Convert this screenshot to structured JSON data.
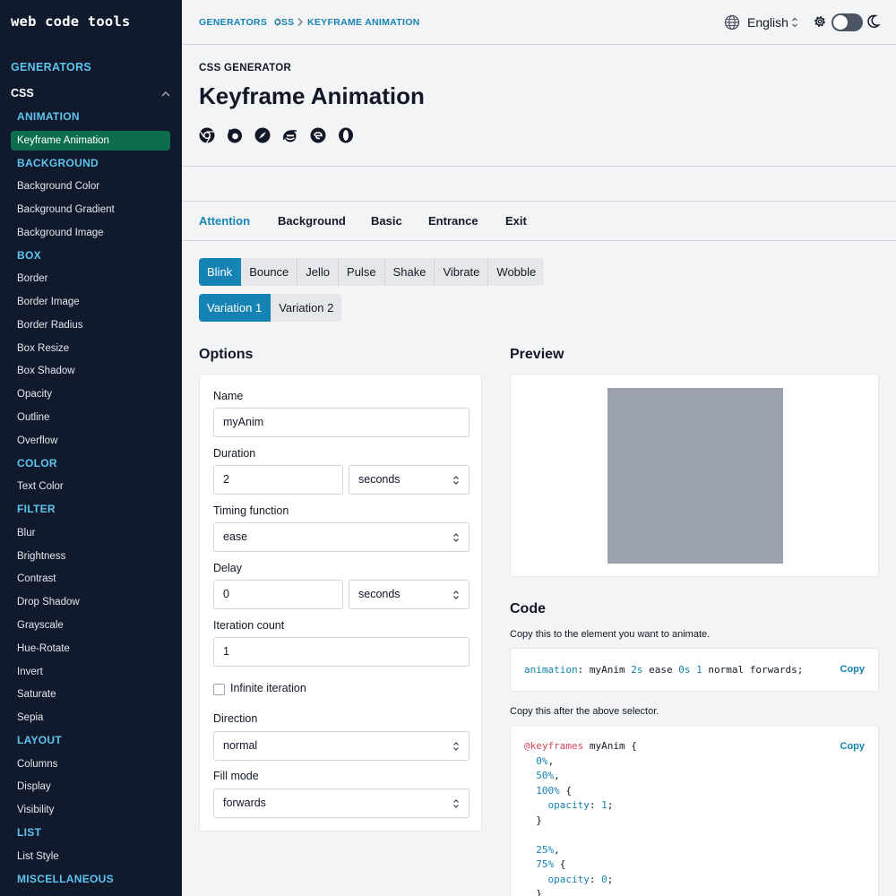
{
  "sidebar": {
    "logo": "web code tools",
    "generators": "GENERATORS",
    "css": "CSS",
    "sections": [
      {
        "heading": "ANIMATION",
        "items": [
          "Keyframe Animation"
        ]
      },
      {
        "heading": "BACKGROUND",
        "items": [
          "Background Color",
          "Background Gradient",
          "Background Image"
        ]
      },
      {
        "heading": "BOX",
        "items": [
          "Border",
          "Border Image",
          "Border Radius",
          "Box Resize",
          "Box Shadow",
          "Opacity",
          "Outline",
          "Overflow"
        ]
      },
      {
        "heading": "COLOR",
        "items": [
          "Text Color"
        ]
      },
      {
        "heading": "FILTER",
        "items": [
          "Blur",
          "Brightness",
          "Contrast",
          "Drop Shadow",
          "Grayscale",
          "Hue-Rotate",
          "Invert",
          "Saturate",
          "Sepia"
        ]
      },
      {
        "heading": "LAYOUT",
        "items": [
          "Columns",
          "Display",
          "Visibility"
        ]
      },
      {
        "heading": "LIST",
        "items": [
          "List Style"
        ]
      },
      {
        "heading": "MISCELLANEOUS",
        "items": []
      }
    ]
  },
  "header": {
    "breadcrumbs": [
      "GENERATORS",
      "CSS",
      "KEYFRAME ANIMATION"
    ],
    "language": "English"
  },
  "hero": {
    "kicker": "CSS GENERATOR",
    "title": "Keyframe Animation",
    "browsers": [
      "chrome-icon",
      "firefox-icon",
      "safari-icon",
      "ie-icon",
      "edge-icon",
      "opera-icon"
    ]
  },
  "tabs": [
    "Attention",
    "Background",
    "Basic",
    "Entrance",
    "Exit"
  ],
  "animations": [
    "Blink",
    "Bounce",
    "Jello",
    "Pulse",
    "Shake",
    "Vibrate",
    "Wobble"
  ],
  "variations": [
    "Variation 1",
    "Variation 2"
  ],
  "options": {
    "heading": "Options",
    "name_label": "Name",
    "name_value": "myAnim",
    "duration_label": "Duration",
    "duration_value": "2",
    "duration_unit": "seconds",
    "timing_label": "Timing function",
    "timing_value": "ease",
    "delay_label": "Delay",
    "delay_value": "0",
    "delay_unit": "seconds",
    "iteration_label": "Iteration count",
    "iteration_value": "1",
    "infinite_label": "Infinite iteration",
    "direction_label": "Direction",
    "direction_value": "normal",
    "fill_label": "Fill mode",
    "fill_value": "forwards"
  },
  "preview": {
    "heading": "Preview"
  },
  "code": {
    "heading": "Code",
    "note1": "Copy this to the element you want to animate.",
    "note2": "Copy this after the above selector.",
    "copy_label": "Copy",
    "animation_line": {
      "prop": "animation",
      "name": "myAnim",
      "duration": "2s",
      "timing": "ease",
      "delay": "0s",
      "count": "1",
      "direction": "normal",
      "fill": "forwards;"
    },
    "keyframes": {
      "at": "@keyframes",
      "name": "myAnim",
      "s0": "0%",
      "s50": "50%",
      "s100": "100%",
      "s25": "25%",
      "s75": "75%",
      "prop": "opacity",
      "v1": "1",
      "v0": "0"
    }
  },
  "colors": {
    "accent": "#1683b5",
    "sidebar_bg": "#101a2c",
    "sidebar_active": "#0d6e4f",
    "sidebar_heading": "#5ec4ee",
    "preview_box": "#9ca3af"
  }
}
